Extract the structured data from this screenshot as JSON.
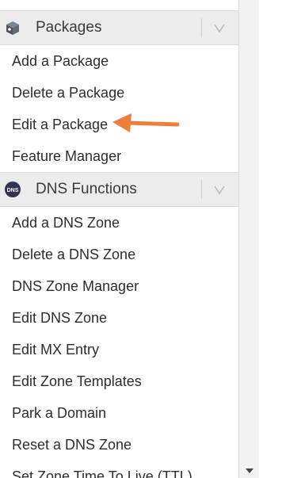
{
  "packages_section": {
    "title": "Packages",
    "icon": "package-box-icon",
    "items": [
      "Add a Package",
      "Delete a Package",
      "Edit a Package",
      "Feature Manager"
    ]
  },
  "dns_section": {
    "title": "DNS Functions",
    "icon": "dns-icon",
    "icon_text": "DNS",
    "items": [
      "Add a DNS Zone",
      "Delete a DNS Zone",
      "DNS Zone Manager",
      "Edit DNS Zone",
      "Edit MX Entry",
      "Edit Zone Templates",
      "Park a Domain",
      "Reset a DNS Zone",
      "Set Zone Time To Live (TTL)"
    ]
  },
  "annotation": {
    "icon": "orange-arrow-icon",
    "points_to": "Edit a Package",
    "color": "#f07c3c"
  },
  "colors": {
    "header_bg": "#ececec",
    "text": "#2d2d2d",
    "arrow": "#f07c3c"
  }
}
